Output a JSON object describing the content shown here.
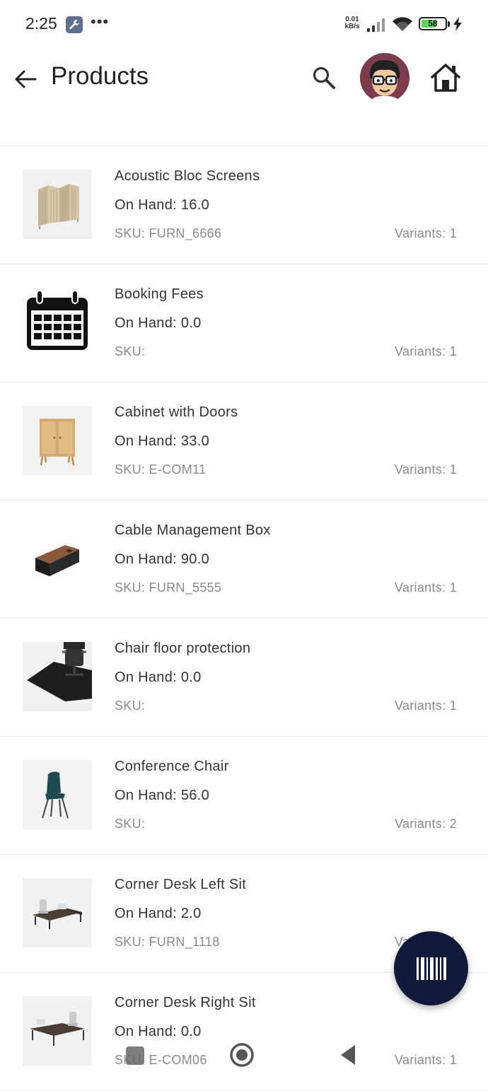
{
  "status_bar": {
    "time": "2:25",
    "net_speed_value": "0.01",
    "net_speed_unit": "kB/s",
    "battery": "58",
    "icons": [
      "wrench-icon",
      "more-dots-icon",
      "signal-icon",
      "wifi-icon",
      "battery-icon",
      "charging-bolt-icon"
    ]
  },
  "header": {
    "title": "Products",
    "icons": [
      "back-arrow-icon",
      "search-icon",
      "avatar",
      "home-icon"
    ]
  },
  "products": [
    {
      "name": "Acoustic Bloc Screens",
      "on_hand": "On Hand: 16.0",
      "sku": "SKU: FURN_6666",
      "variants": "Variants: 1"
    },
    {
      "name": "Booking Fees",
      "on_hand": "On Hand: 0.0",
      "sku": "SKU:",
      "variants": "Variants: 1"
    },
    {
      "name": "Cabinet with Doors",
      "on_hand": "On Hand: 33.0",
      "sku": "SKU: E-COM11",
      "variants": "Variants: 1"
    },
    {
      "name": "Cable Management Box",
      "on_hand": "On Hand: 90.0",
      "sku": "SKU: FURN_5555",
      "variants": "Variants: 1"
    },
    {
      "name": "Chair floor protection",
      "on_hand": "On Hand: 0.0",
      "sku": "SKU:",
      "variants": "Variants: 1"
    },
    {
      "name": "Conference Chair",
      "on_hand": "On Hand: 56.0",
      "sku": "SKU:",
      "variants": "Variants: 2"
    },
    {
      "name": "Corner Desk Left Sit",
      "on_hand": "On Hand: 2.0",
      "sku": "SKU: FURN_1118",
      "variants": "Variants: 1"
    },
    {
      "name": "Corner Desk Right Sit",
      "on_hand": "On Hand: 0.0",
      "sku": "SKU: E-COM06",
      "variants": "Variants: 1"
    }
  ],
  "fab": {
    "icon": "barcode-icon"
  },
  "colors": {
    "fab": "#111a3a",
    "battery_fill": "#5fd35a",
    "divider": "#ececec"
  }
}
